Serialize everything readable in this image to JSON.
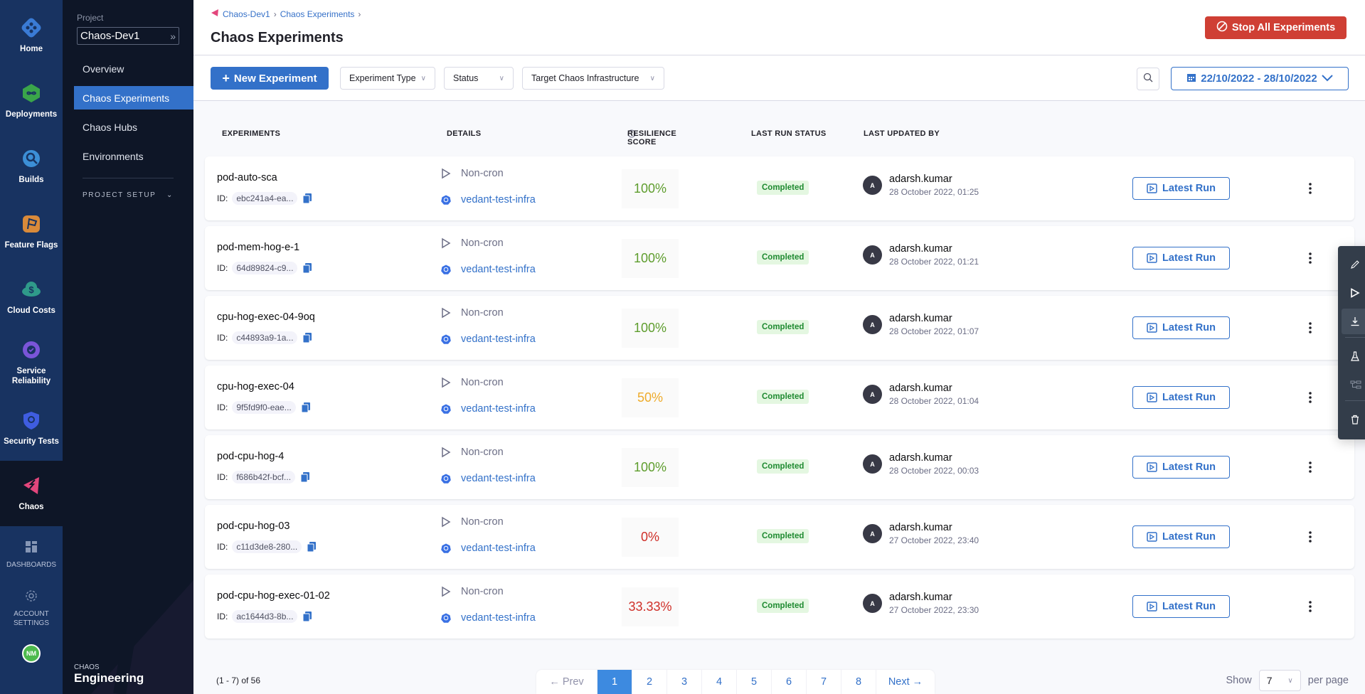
{
  "rail": {
    "items": [
      {
        "label": "Home",
        "color": "#3a7bd5"
      },
      {
        "label": "Deployments",
        "color": "#3aa54a"
      },
      {
        "label": "Builds",
        "color": "#3c8fd6"
      },
      {
        "label": "Feature Flags",
        "color": "#d98a3a"
      },
      {
        "label": "Cloud Costs",
        "color": "#2f9a8a"
      },
      {
        "label": "Service Reliability",
        "color": "#7a55d8"
      },
      {
        "label": "Security Tests",
        "color": "#3f5de0"
      },
      {
        "label": "Chaos",
        "color": "#e3467c"
      }
    ],
    "dashboards": "DASHBOARDS",
    "account_settings": "ACCOUNT SETTINGS",
    "avatar_initials": "NM"
  },
  "sidebar": {
    "project_label": "Project",
    "project_name": "Chaos-Dev1",
    "nav": [
      {
        "label": "Overview",
        "active": false
      },
      {
        "label": "Chaos Experiments",
        "active": true
      },
      {
        "label": "Chaos Hubs",
        "active": false
      },
      {
        "label": "Environments",
        "active": false
      }
    ],
    "project_setup": "PROJECT SETUP",
    "footer_small": "CHAOS",
    "footer_big": "Engineering"
  },
  "header": {
    "breadcrumbs": [
      "Chaos-Dev1",
      "Chaos Experiments"
    ],
    "title": "Chaos Experiments",
    "stop_all": "Stop All Experiments"
  },
  "toolbar": {
    "new_experiment": "New Experiment",
    "filters": [
      "Experiment Type",
      "Status",
      "Target Chaos Infrastructure"
    ],
    "date_range": "22/10/2022 - 28/10/2022"
  },
  "table": {
    "columns": [
      "EXPERIMENTS",
      "DETAILS",
      "RESILIENCE SCORE",
      "LAST RUN STATUS",
      "LAST UPDATED BY"
    ],
    "id_label": "ID:",
    "latest_run_label": "Latest Run",
    "rows": [
      {
        "name": "pod-auto-sca",
        "id": "ebc241a4-ea...",
        "type": "Non-cron",
        "infra": "vedant-test-infra",
        "score": "100%",
        "score_color": "#5e9d2d",
        "status": "Completed",
        "user": "adarsh.kumar",
        "initial": "A",
        "date": "28 October 2022, 01:25"
      },
      {
        "name": "pod-mem-hog-e-1",
        "id": "64d89824-c9...",
        "type": "Non-cron",
        "infra": "vedant-test-infra",
        "score": "100%",
        "score_color": "#5e9d2d",
        "status": "Completed",
        "user": "adarsh.kumar",
        "initial": "A",
        "date": "28 October 2022, 01:21"
      },
      {
        "name": "cpu-hog-exec-04-9oq",
        "id": "c44893a9-1a...",
        "type": "Non-cron",
        "infra": "vedant-test-infra",
        "score": "100%",
        "score_color": "#5e9d2d",
        "status": "Completed",
        "user": "adarsh.kumar",
        "initial": "A",
        "date": "28 October 2022, 01:07"
      },
      {
        "name": "cpu-hog-exec-04",
        "id": "9f5fd9f0-eae...",
        "type": "Non-cron",
        "infra": "vedant-test-infra",
        "score": "50%",
        "score_color": "#eeab2b",
        "status": "Completed",
        "user": "adarsh.kumar",
        "initial": "A",
        "date": "28 October 2022, 01:04"
      },
      {
        "name": "pod-cpu-hog-4",
        "id": "f686b42f-bcf...",
        "type": "Non-cron",
        "infra": "vedant-test-infra",
        "score": "100%",
        "score_color": "#5e9d2d",
        "status": "Completed",
        "user": "adarsh.kumar",
        "initial": "A",
        "date": "28 October 2022, 00:03"
      },
      {
        "name": "pod-cpu-hog-03",
        "id": "c11d3de8-280...",
        "type": "Non-cron",
        "infra": "vedant-test-infra",
        "score": "0%",
        "score_color": "#cf2f28",
        "status": "Completed",
        "user": "adarsh.kumar",
        "initial": "A",
        "date": "27 October 2022, 23:40"
      },
      {
        "name": "pod-cpu-hog-exec-01-02",
        "id": "ac1644d3-8b...",
        "type": "Non-cron",
        "infra": "vedant-test-infra",
        "score": "33.33%",
        "score_color": "#cf2f28",
        "status": "Completed",
        "user": "adarsh.kumar",
        "initial": "A",
        "date": "27 October 2022, 23:30"
      }
    ]
  },
  "context_menu": {
    "items": [
      {
        "label": "Edit Experiment",
        "icon": "pencil-icon",
        "state": "normal"
      },
      {
        "label": "Run Experiment",
        "icon": "play-icon",
        "state": "normal"
      },
      {
        "label": "Download Experiment",
        "icon": "download-icon",
        "state": "hover"
      },
      {
        "label": "Add to Chaos Hub",
        "icon": "flask-icon",
        "state": "normal"
      },
      {
        "label": "Add to Pipeline",
        "icon": "pipeline-icon",
        "state": "disabled"
      },
      {
        "label": "Delete Experiment",
        "icon": "trash-icon",
        "state": "normal"
      }
    ]
  },
  "pagination": {
    "summary": "(1 - 7) of 56",
    "prev": "Prev",
    "next": "Next",
    "pages": [
      "1",
      "2",
      "3",
      "4",
      "5",
      "6",
      "7",
      "8"
    ],
    "current": "1",
    "show_label": "Show",
    "per_page_value": "7",
    "per_page_label": "per page"
  }
}
